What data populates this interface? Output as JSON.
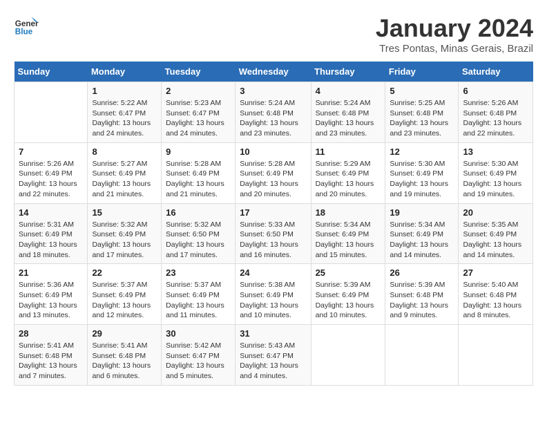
{
  "logo": {
    "line1": "General",
    "line2": "Blue"
  },
  "title": "January 2024",
  "subtitle": "Tres Pontas, Minas Gerais, Brazil",
  "header": {
    "days": [
      "Sunday",
      "Monday",
      "Tuesday",
      "Wednesday",
      "Thursday",
      "Friday",
      "Saturday"
    ]
  },
  "weeks": [
    [
      {
        "day": "",
        "info": ""
      },
      {
        "day": "1",
        "info": "Sunrise: 5:22 AM\nSunset: 6:47 PM\nDaylight: 13 hours\nand 24 minutes."
      },
      {
        "day": "2",
        "info": "Sunrise: 5:23 AM\nSunset: 6:47 PM\nDaylight: 13 hours\nand 24 minutes."
      },
      {
        "day": "3",
        "info": "Sunrise: 5:24 AM\nSunset: 6:48 PM\nDaylight: 13 hours\nand 23 minutes."
      },
      {
        "day": "4",
        "info": "Sunrise: 5:24 AM\nSunset: 6:48 PM\nDaylight: 13 hours\nand 23 minutes."
      },
      {
        "day": "5",
        "info": "Sunrise: 5:25 AM\nSunset: 6:48 PM\nDaylight: 13 hours\nand 23 minutes."
      },
      {
        "day": "6",
        "info": "Sunrise: 5:26 AM\nSunset: 6:48 PM\nDaylight: 13 hours\nand 22 minutes."
      }
    ],
    [
      {
        "day": "7",
        "info": "Sunrise: 5:26 AM\nSunset: 6:49 PM\nDaylight: 13 hours\nand 22 minutes."
      },
      {
        "day": "8",
        "info": "Sunrise: 5:27 AM\nSunset: 6:49 PM\nDaylight: 13 hours\nand 21 minutes."
      },
      {
        "day": "9",
        "info": "Sunrise: 5:28 AM\nSunset: 6:49 PM\nDaylight: 13 hours\nand 21 minutes."
      },
      {
        "day": "10",
        "info": "Sunrise: 5:28 AM\nSunset: 6:49 PM\nDaylight: 13 hours\nand 20 minutes."
      },
      {
        "day": "11",
        "info": "Sunrise: 5:29 AM\nSunset: 6:49 PM\nDaylight: 13 hours\nand 20 minutes."
      },
      {
        "day": "12",
        "info": "Sunrise: 5:30 AM\nSunset: 6:49 PM\nDaylight: 13 hours\nand 19 minutes."
      },
      {
        "day": "13",
        "info": "Sunrise: 5:30 AM\nSunset: 6:49 PM\nDaylight: 13 hours\nand 19 minutes."
      }
    ],
    [
      {
        "day": "14",
        "info": "Sunrise: 5:31 AM\nSunset: 6:49 PM\nDaylight: 13 hours\nand 18 minutes."
      },
      {
        "day": "15",
        "info": "Sunrise: 5:32 AM\nSunset: 6:49 PM\nDaylight: 13 hours\nand 17 minutes."
      },
      {
        "day": "16",
        "info": "Sunrise: 5:32 AM\nSunset: 6:50 PM\nDaylight: 13 hours\nand 17 minutes."
      },
      {
        "day": "17",
        "info": "Sunrise: 5:33 AM\nSunset: 6:50 PM\nDaylight: 13 hours\nand 16 minutes."
      },
      {
        "day": "18",
        "info": "Sunrise: 5:34 AM\nSunset: 6:49 PM\nDaylight: 13 hours\nand 15 minutes."
      },
      {
        "day": "19",
        "info": "Sunrise: 5:34 AM\nSunset: 6:49 PM\nDaylight: 13 hours\nand 14 minutes."
      },
      {
        "day": "20",
        "info": "Sunrise: 5:35 AM\nSunset: 6:49 PM\nDaylight: 13 hours\nand 14 minutes."
      }
    ],
    [
      {
        "day": "21",
        "info": "Sunrise: 5:36 AM\nSunset: 6:49 PM\nDaylight: 13 hours\nand 13 minutes."
      },
      {
        "day": "22",
        "info": "Sunrise: 5:37 AM\nSunset: 6:49 PM\nDaylight: 13 hours\nand 12 minutes."
      },
      {
        "day": "23",
        "info": "Sunrise: 5:37 AM\nSunset: 6:49 PM\nDaylight: 13 hours\nand 11 minutes."
      },
      {
        "day": "24",
        "info": "Sunrise: 5:38 AM\nSunset: 6:49 PM\nDaylight: 13 hours\nand 10 minutes."
      },
      {
        "day": "25",
        "info": "Sunrise: 5:39 AM\nSunset: 6:49 PM\nDaylight: 13 hours\nand 10 minutes."
      },
      {
        "day": "26",
        "info": "Sunrise: 5:39 AM\nSunset: 6:48 PM\nDaylight: 13 hours\nand 9 minutes."
      },
      {
        "day": "27",
        "info": "Sunrise: 5:40 AM\nSunset: 6:48 PM\nDaylight: 13 hours\nand 8 minutes."
      }
    ],
    [
      {
        "day": "28",
        "info": "Sunrise: 5:41 AM\nSunset: 6:48 PM\nDaylight: 13 hours\nand 7 minutes."
      },
      {
        "day": "29",
        "info": "Sunrise: 5:41 AM\nSunset: 6:48 PM\nDaylight: 13 hours\nand 6 minutes."
      },
      {
        "day": "30",
        "info": "Sunrise: 5:42 AM\nSunset: 6:47 PM\nDaylight: 13 hours\nand 5 minutes."
      },
      {
        "day": "31",
        "info": "Sunrise: 5:43 AM\nSunset: 6:47 PM\nDaylight: 13 hours\nand 4 minutes."
      },
      {
        "day": "",
        "info": ""
      },
      {
        "day": "",
        "info": ""
      },
      {
        "day": "",
        "info": ""
      }
    ]
  ]
}
